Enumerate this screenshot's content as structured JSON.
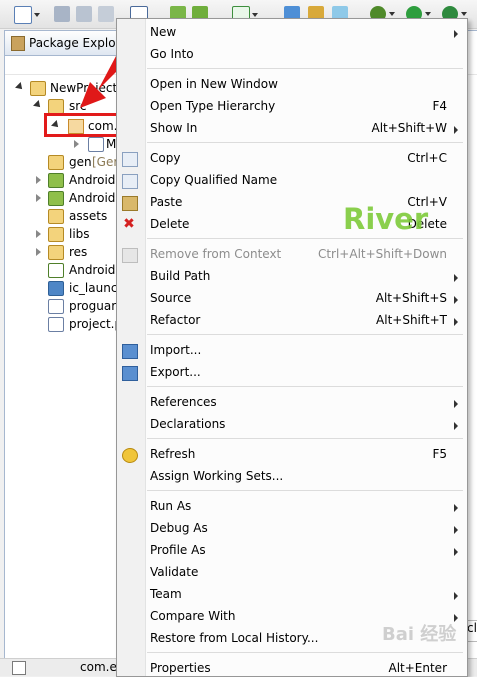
{
  "view": {
    "title": "Package Explorer"
  },
  "tree": {
    "project": "NewProject",
    "src": "src",
    "package": "com.",
    "file": "M",
    "gen": "gen",
    "gen_suffix": "[Ger",
    "android1": "Android",
    "android2": "Android",
    "assets": "assets",
    "libs": "libs",
    "res": "res",
    "manifest": "AndroidM",
    "ic_launcher": "ic_launch",
    "proguard": "proguarc",
    "project_props": "project.p"
  },
  "statusbar": {
    "text": "com.ex"
  },
  "right_edge_fragment": "cl",
  "watermark": "River",
  "baidu_watermark": "Bai 经验",
  "menu": {
    "new": {
      "label": "New"
    },
    "go_into": {
      "label": "Go Into"
    },
    "open_in_new_window": {
      "label": "Open in New Window"
    },
    "open_type_hierarchy": {
      "label": "Open Type Hierarchy",
      "shortcut": "F4"
    },
    "show_in": {
      "label": "Show In",
      "shortcut": "Alt+Shift+W"
    },
    "copy": {
      "label": "Copy",
      "shortcut": "Ctrl+C"
    },
    "copy_qualified_name": {
      "label": "Copy Qualified Name"
    },
    "paste": {
      "label": "Paste",
      "shortcut": "Ctrl+V"
    },
    "delete": {
      "label": "Delete",
      "shortcut": "Delete"
    },
    "remove_from_context": {
      "label": "Remove from Context",
      "shortcut": "Ctrl+Alt+Shift+Down"
    },
    "build_path": {
      "label": "Build Path"
    },
    "source": {
      "label": "Source",
      "shortcut": "Alt+Shift+S"
    },
    "refactor": {
      "label": "Refactor",
      "shortcut": "Alt+Shift+T"
    },
    "import": {
      "label": "Import..."
    },
    "export": {
      "label": "Export..."
    },
    "references": {
      "label": "References"
    },
    "declarations": {
      "label": "Declarations"
    },
    "refresh": {
      "label": "Refresh",
      "shortcut": "F5"
    },
    "assign_working_sets": {
      "label": "Assign Working Sets..."
    },
    "run_as": {
      "label": "Run As"
    },
    "debug_as": {
      "label": "Debug As"
    },
    "profile_as": {
      "label": "Profile As"
    },
    "validate": {
      "label": "Validate"
    },
    "team": {
      "label": "Team"
    },
    "compare_with": {
      "label": "Compare With"
    },
    "restore_from_local_history": {
      "label": "Restore from Local History..."
    },
    "properties": {
      "label": "Properties",
      "shortcut": "Alt+Enter"
    }
  }
}
